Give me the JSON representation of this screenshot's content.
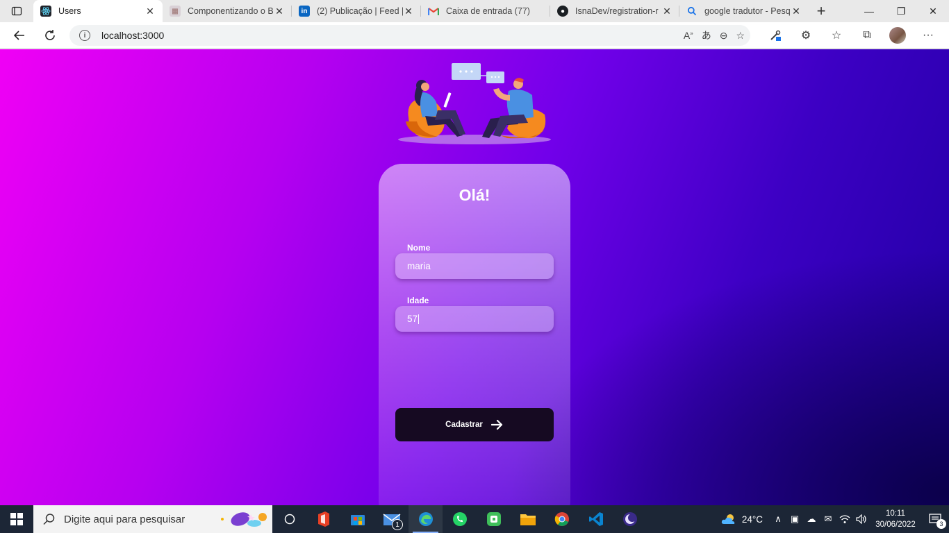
{
  "browser": {
    "tabs": [
      {
        "title": "Users",
        "favicon": "react-icon",
        "active": true
      },
      {
        "title": "Componentizando o B",
        "favicon": "page-icon"
      },
      {
        "title": "(2) Publicação | Feed |",
        "favicon": "linkedin-icon"
      },
      {
        "title": "Caixa de entrada (77)",
        "favicon": "gmail-icon"
      },
      {
        "title": "IsnaDev/registration-r",
        "favicon": "github-icon"
      },
      {
        "title": "google tradutor - Pesq",
        "favicon": "search-icon"
      }
    ],
    "address": "localhost:3000"
  },
  "app": {
    "greeting": "Olá!",
    "name_label": "Nome",
    "name_value": "maria",
    "age_label": "Idade",
    "age_value": "57",
    "submit_label": "Cadastrar"
  },
  "taskbar": {
    "search_placeholder": "Digite aqui para pesquisar",
    "mail_badge": "1",
    "temperature": "24°C",
    "time": "10:11",
    "date": "30/06/2022",
    "notifications_count": "3"
  },
  "colors": {
    "page_gradient_start": "#f000f5",
    "page_gradient_end": "#1d00a0",
    "button_bg": "#160a22"
  }
}
